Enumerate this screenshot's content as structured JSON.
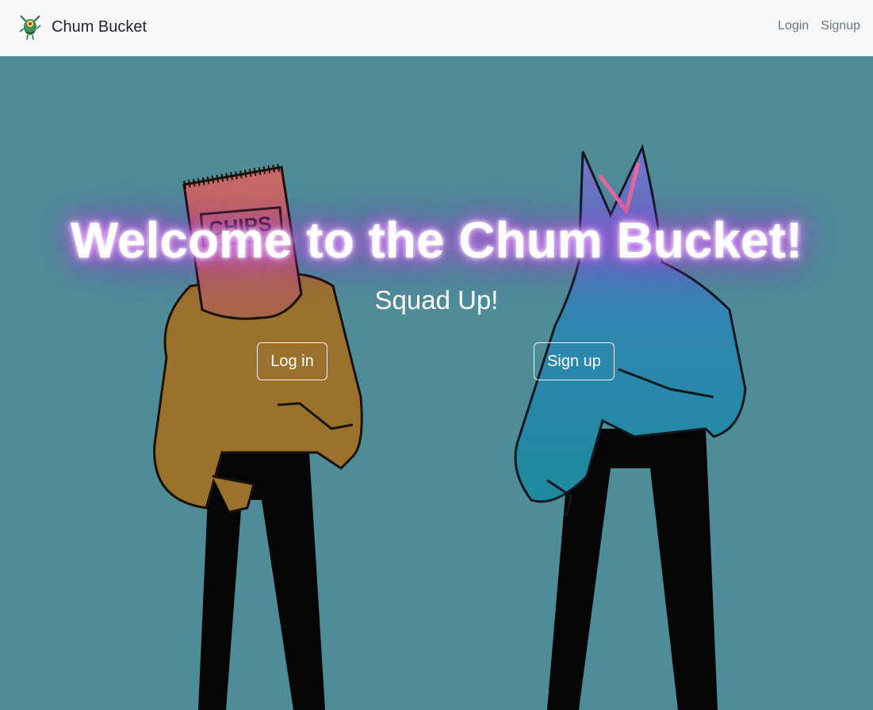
{
  "navbar": {
    "brand_name": "Chum Bucket",
    "brand_logo_icon": "plankton-logo-icon",
    "links": [
      {
        "label": "Login"
      },
      {
        "label": "Signup"
      }
    ]
  },
  "hero": {
    "title": "Welcome to the Chum Bucket!",
    "subtitle": "Squad Up!",
    "login_button": "Log in",
    "signup_button": "Sign up",
    "background_image": "two-cartoon-figures-chips-bag-head-and-cat-ears",
    "chips_bag_text": "CHIPS"
  },
  "colors": {
    "navbar_bg": "#f7f8fa",
    "hero_bg": "#4e8d98",
    "title_glow": "#b04ae0",
    "left_figure_shirt": "#9a722e",
    "right_figure_body": "#1e8a9e"
  }
}
